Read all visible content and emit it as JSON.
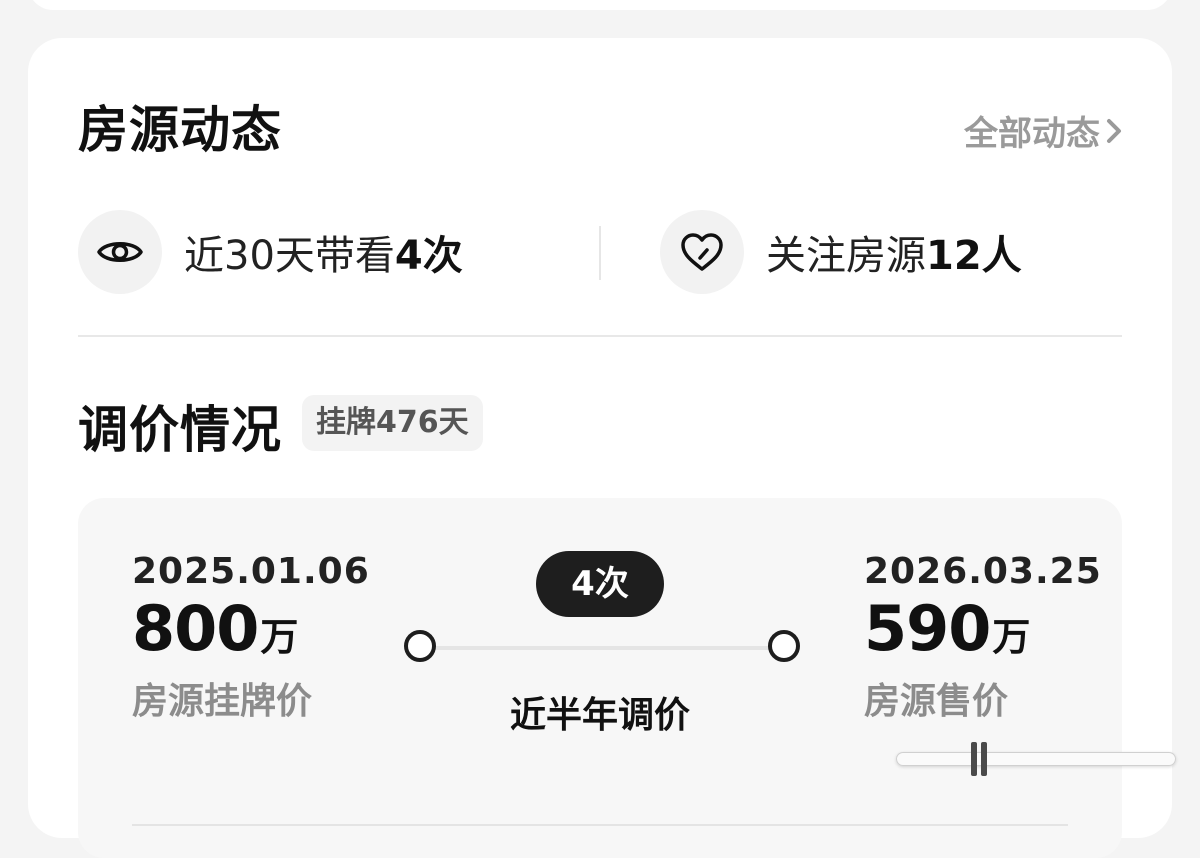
{
  "activity": {
    "title": "房源动态",
    "all_link": "全部动态",
    "views": {
      "icon": "eye-icon",
      "prefix": "近30天带看",
      "count": "4次"
    },
    "follows": {
      "icon": "heart-icon",
      "prefix": "关注房源",
      "count": "12人"
    }
  },
  "price_adjust": {
    "title": "调价情况",
    "listing_tag": "挂牌476天",
    "start": {
      "date": "2025.01.06",
      "price": "800",
      "unit": "万",
      "label": "房源挂牌价"
    },
    "end": {
      "date": "2026.03.25",
      "price": "590",
      "unit": "万",
      "label": "房源售价"
    },
    "adjust_count": "4次",
    "timeline_label": "近半年调价"
  },
  "colors": {
    "accent_dark": "#1e1e1e",
    "muted_text": "#9a9a9a",
    "card_bg": "#ffffff",
    "page_bg": "#f4f4f4"
  }
}
